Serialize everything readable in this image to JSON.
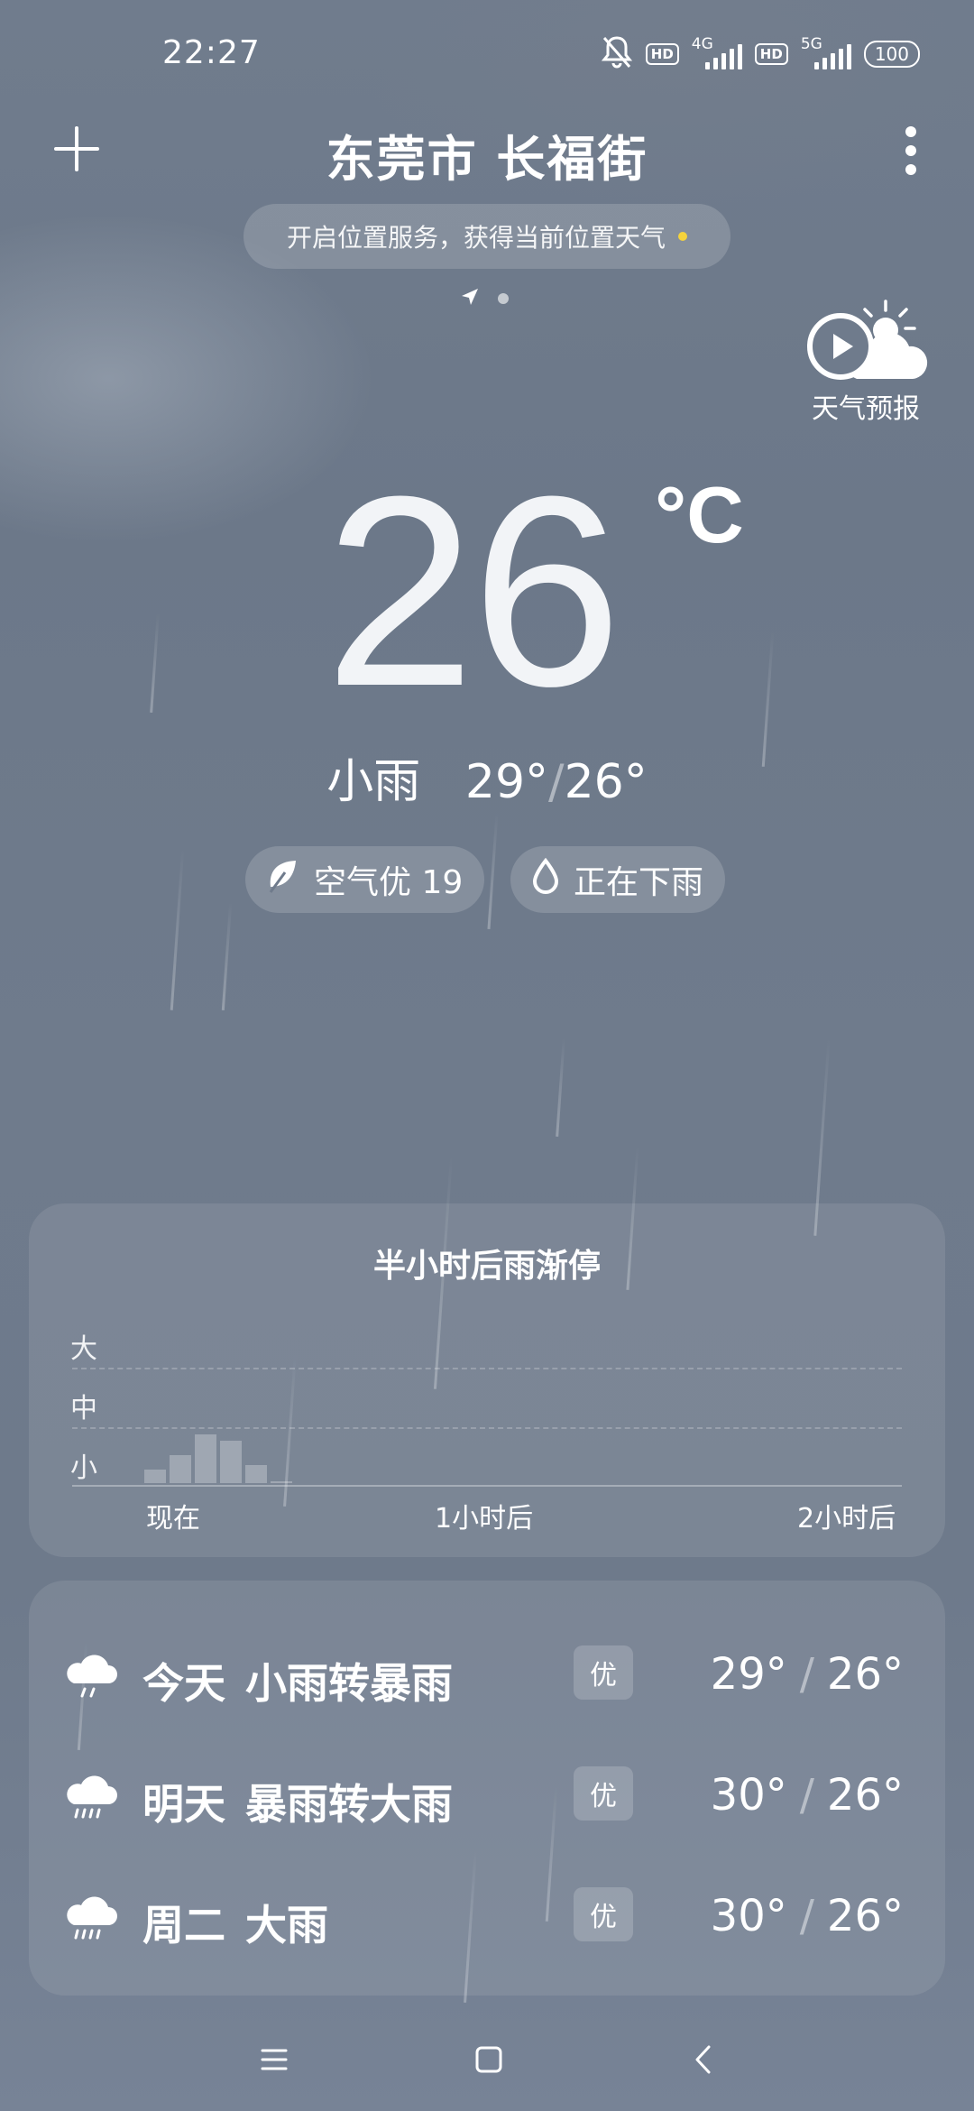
{
  "status_bar": {
    "time": "22:27",
    "hd1": "HD",
    "net1": "4G",
    "hd2": "HD",
    "net2": "5G",
    "battery": "100"
  },
  "header": {
    "city": "东莞市 长福街",
    "location_prompt": "开启位置服务，获得当前位置天气",
    "forecast_video_label": "天气预报"
  },
  "current": {
    "temperature": "26",
    "unit": "°C",
    "condition": "小雨",
    "high": "29°",
    "separator": "/",
    "low": "26°",
    "air_quality": "空气优 19",
    "rain_status": "正在下雨"
  },
  "precipitation": {
    "title": "半小时后雨渐停",
    "levels": [
      "大",
      "中",
      "小"
    ],
    "x_labels": [
      "现在",
      "1小时后",
      "2小时后"
    ],
    "intensity": [
      0.15,
      0.32,
      0.55,
      0.48,
      0.2,
      0.02
    ]
  },
  "daily": [
    {
      "day": "今天",
      "condition": "小雨转暴雨",
      "aqi": "优",
      "high": "29°",
      "low": "26°",
      "icon": "light-rain-icon"
    },
    {
      "day": "明天",
      "condition": "暴雨转大雨",
      "aqi": "优",
      "high": "30°",
      "low": "26°",
      "icon": "heavy-rain-icon"
    },
    {
      "day": "周二",
      "condition": "大雨",
      "aqi": "优",
      "high": "30°",
      "low": "26°",
      "icon": "heavy-rain-icon"
    }
  ],
  "colors": {
    "background": "#6f7b8c",
    "location_dot": "#f5d33c"
  }
}
